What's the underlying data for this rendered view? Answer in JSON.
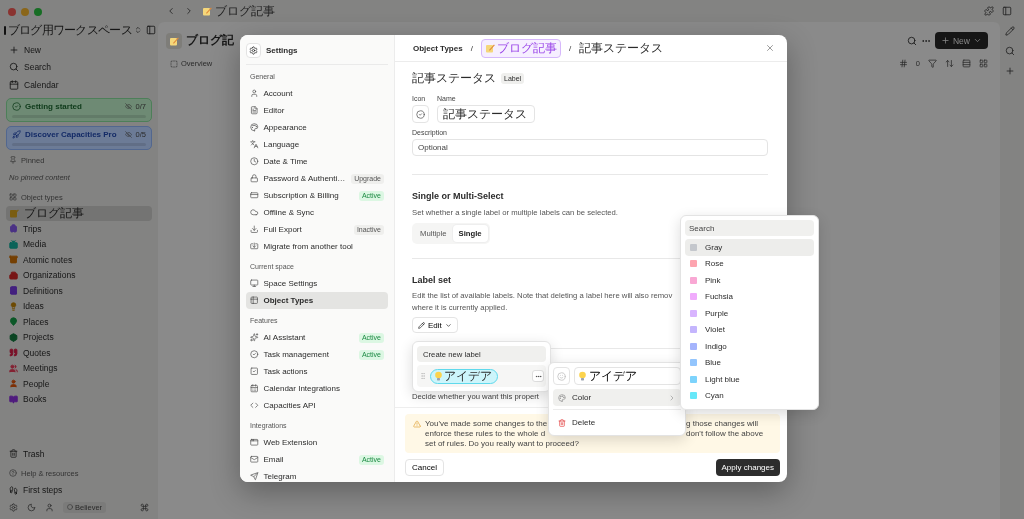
{
  "app_sidebar": {
    "workspace": "ブログ用ワークスペース",
    "actions": [
      "New",
      "Search",
      "Calendar"
    ],
    "progress_cards": [
      {
        "title": "Getting started",
        "count": "0/7",
        "level": 0,
        "color": "#4d7f59"
      },
      {
        "title": "Discover Capacities Pro",
        "count": "0/5",
        "level": 0,
        "color": "#52678f"
      }
    ],
    "pinned_heading": "Pinned",
    "pinned_empty": "No pinned content",
    "types_heading": "Object types",
    "object_types": [
      {
        "label": "ブログ記事",
        "selected": true,
        "color": "#7a5d12"
      },
      {
        "label": "Trips",
        "selected": false,
        "color": "#4b3285"
      },
      {
        "label": "Media",
        "selected": false,
        "color": "#0b6359"
      },
      {
        "label": "Atomic notes",
        "selected": false,
        "color": "#754003"
      },
      {
        "label": "Organizations",
        "selected": false,
        "color": "#771515"
      },
      {
        "label": "Definitions",
        "selected": false,
        "color": "#43207f"
      },
      {
        "label": "Ideas",
        "selected": false,
        "color": "#6d4a02"
      },
      {
        "label": "Places",
        "selected": false,
        "color": "#0c5828"
      },
      {
        "label": "Projects",
        "selected": false,
        "color": "#0b4523"
      },
      {
        "label": "Quotes",
        "selected": false,
        "color": "#7a1027"
      },
      {
        "label": "Meetings",
        "selected": false,
        "color": "#842233"
      },
      {
        "label": "People",
        "selected": false,
        "color": "#7e3006"
      },
      {
        "label": "Books",
        "selected": false,
        "color": "#4f1b7e"
      }
    ],
    "trash": "Trash",
    "help_heading": "Help & resources",
    "first_steps": "First steps",
    "plan": "Believer"
  },
  "top_bar": {
    "breadcrumb": "ブログ記事"
  },
  "page": {
    "title": "ブログ記",
    "tabs": [
      {
        "label": "Overview",
        "selected": false
      }
    ],
    "new_button": "New",
    "count": "0"
  },
  "settings": {
    "title": "Settings",
    "sections": [
      {
        "heading": "General",
        "items": [
          {
            "label": "Account",
            "selected": false
          },
          {
            "label": "Editor",
            "selected": false
          },
          {
            "label": "Appearance",
            "selected": false
          },
          {
            "label": "Language",
            "selected": false
          },
          {
            "label": "Date & Time",
            "selected": false
          },
          {
            "label": "Password & Authenti…",
            "selected": false,
            "badge": {
              "text": "Upgrade",
              "kind": "neutral"
            }
          },
          {
            "label": "Subscription & Billing",
            "selected": false,
            "badge": {
              "text": "Active",
              "kind": "active"
            }
          },
          {
            "label": "Offline & Sync",
            "selected": false
          },
          {
            "label": "Full Export",
            "selected": false,
            "badge": {
              "text": "Inactive",
              "kind": "neutral"
            }
          },
          {
            "label": "Migrate from another tool",
            "selected": false
          }
        ]
      },
      {
        "heading": "Current space",
        "items": [
          {
            "label": "Space Settings",
            "selected": false
          },
          {
            "label": "Object Types",
            "selected": true
          }
        ]
      },
      {
        "heading": "Features",
        "items": [
          {
            "label": "AI Assistant",
            "selected": false,
            "badge": {
              "text": "Active",
              "kind": "active"
            }
          },
          {
            "label": "Task management",
            "selected": false,
            "badge": {
              "text": "Active",
              "kind": "active"
            }
          },
          {
            "label": "Task actions",
            "selected": false
          },
          {
            "label": "Calendar Integrations",
            "selected": false
          },
          {
            "label": "Capacities API",
            "selected": false
          }
        ]
      },
      {
        "heading": "Integrations",
        "items": [
          {
            "label": "Web Extension",
            "selected": false
          },
          {
            "label": "Email",
            "selected": false,
            "badge": {
              "text": "Active",
              "kind": "active"
            }
          },
          {
            "label": "Telegram",
            "selected": false
          }
        ]
      }
    ]
  },
  "editor": {
    "breadcrumb": [
      {
        "text": "Object Types",
        "kind": "link"
      },
      {
        "text": "/",
        "kind": "separator"
      },
      {
        "text": "ブログ記事",
        "kind": "chip"
      },
      {
        "text": "/",
        "kind": "separator"
      },
      {
        "text": "記事ステータス",
        "kind": "current"
      }
    ],
    "property": {
      "name": "記事ステータス",
      "type_badge": "Label",
      "icon_label": "Icon",
      "name_label": "Name",
      "name_value": "記事ステータス",
      "description_label": "Description",
      "description_placeholder": "Optional"
    },
    "select_mode": {
      "title": "Single or Multi-Select",
      "description": "Set whether a single label or multiple labels can be selected.",
      "options": [
        {
          "label": "Multiple",
          "selected": false
        },
        {
          "label": "Single",
          "selected": true
        }
      ]
    },
    "label_set": {
      "title": "Label set",
      "description_lines": [
        "Edit the list of available labels. Note that deleting a label here will also remov",
        "where it is currently applied."
      ],
      "edit_button": "Edit"
    },
    "required_hint": "Decide whether you want this propert",
    "warning_lines": [
      {
        "left": "You've made some changes to the",
        "right": "g those changes will"
      },
      {
        "left": "enforce these rules to the whole d",
        "right": "don't follow the above"
      },
      {
        "left": "set of rules. Do you really want to proceed?"
      }
    ],
    "cancel_button": "Cancel",
    "apply_button": "Apply changes"
  },
  "label_popover": {
    "create_label": "Create new label",
    "labels": [
      {
        "text": "アイデア",
        "color": "#cdf5fb"
      }
    ]
  },
  "label_menu": {
    "value": "アイデア",
    "items": [
      {
        "label": "Color",
        "kind": "submenu",
        "selected": true
      },
      {
        "label": "Delete",
        "kind": "danger",
        "selected": false
      }
    ]
  },
  "color_picker": {
    "placeholder": "Search",
    "options": [
      {
        "label": "Gray",
        "color": "#c4c7cc",
        "selected": true
      },
      {
        "label": "Rose",
        "color": "#fda4af",
        "selected": false
      },
      {
        "label": "Pink",
        "color": "#f9a8d4",
        "selected": false
      },
      {
        "label": "Fuchsia",
        "color": "#f0abfc",
        "selected": false
      },
      {
        "label": "Purple",
        "color": "#d8b4fe",
        "selected": false
      },
      {
        "label": "Violet",
        "color": "#c4b5fd",
        "selected": false
      },
      {
        "label": "Indigo",
        "color": "#a5b4fc",
        "selected": false
      },
      {
        "label": "Blue",
        "color": "#93c5fd",
        "selected": false
      },
      {
        "label": "Light blue",
        "color": "#7dd3fc",
        "selected": false
      },
      {
        "label": "Cyan",
        "color": "#67e8f9",
        "selected": false
      }
    ]
  }
}
